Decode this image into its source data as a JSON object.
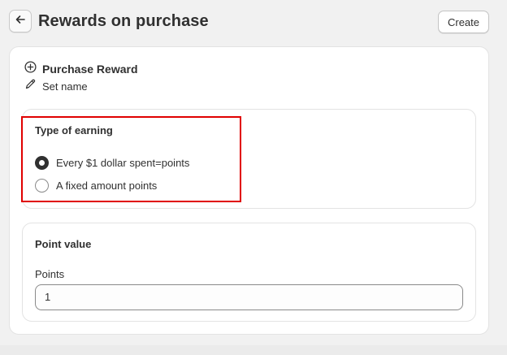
{
  "header": {
    "title": "Rewards on purchase",
    "create_label": "Create"
  },
  "reward": {
    "title": "Purchase Reward",
    "set_name_label": "Set name"
  },
  "earning": {
    "title": "Type of earning",
    "options": [
      {
        "label": "Every $1 dollar spent=points",
        "selected": true
      },
      {
        "label": "A fixed amount points",
        "selected": false
      }
    ]
  },
  "point_value": {
    "title": "Point value",
    "points_label": "Points",
    "points_value": "1"
  },
  "colors": {
    "highlight": "#e00000",
    "text": "#303030",
    "background": "#f1f1f1"
  },
  "icons": {
    "back": "arrow-left-icon",
    "add": "plus-circle-icon",
    "edit": "pencil-icon"
  }
}
